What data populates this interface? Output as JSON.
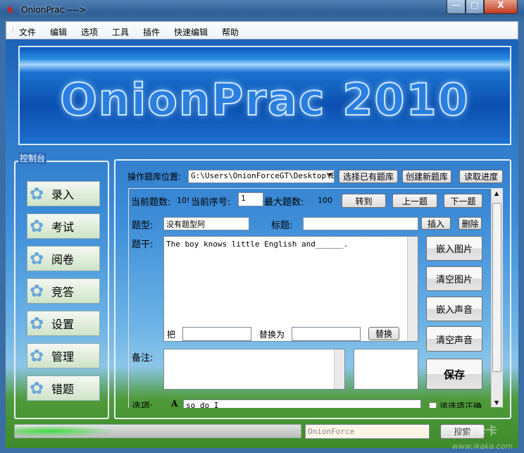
{
  "window": {
    "title": "OnionPrac ---->",
    "min": "—",
    "max": "□",
    "close": "X"
  },
  "menu": [
    "文件",
    "编辑",
    "选项",
    "工具",
    "插件",
    "快速编辑",
    "帮助"
  ],
  "banner": {
    "logo": "OnionPrac 2010"
  },
  "console": {
    "label": "控制台",
    "buttons": [
      "录入",
      "考试",
      "阅卷",
      "竞答",
      "设置",
      "管理",
      "错题"
    ]
  },
  "bank": {
    "label": "操作题库位置:",
    "path": "G:\\Users\\OnionForceGT\\Desktop\\E",
    "select": "选择已有题库",
    "create": "创建新题库",
    "load": "读取进度"
  },
  "editor": {
    "count_label": "当前题数:",
    "count": "10!",
    "index_label": "当前序号:",
    "index": "1",
    "max_label": "最大题数:",
    "max": "100",
    "goto": "转到",
    "prev": "上一题",
    "next": "下一题",
    "type_label": "题型:",
    "type": "没有题型阿",
    "heading_label": "标题:",
    "heading": "",
    "insert": "插入",
    "delete": "删除",
    "stem_label": "题干:",
    "stem": "The boy knows little English and______.",
    "replace_from_label": "把",
    "replace_to_label": "替换为",
    "replace": "替换",
    "embed_image": "嵌入图片",
    "clear_image": "清空图片",
    "embed_sound": "嵌入声音",
    "clear_sound": "清空声音",
    "save": "保存",
    "note_label": "备注:",
    "options_label": "选项:",
    "option_letter": "A",
    "option_text": "so do I",
    "correct_label": "该选项正确"
  },
  "status": {
    "progress": 0.1,
    "search_text": "OnionForce",
    "search": "搜索"
  },
  "watermark": {
    "text": "瑞星卡卡",
    "url": "www.ikaka.com"
  }
}
